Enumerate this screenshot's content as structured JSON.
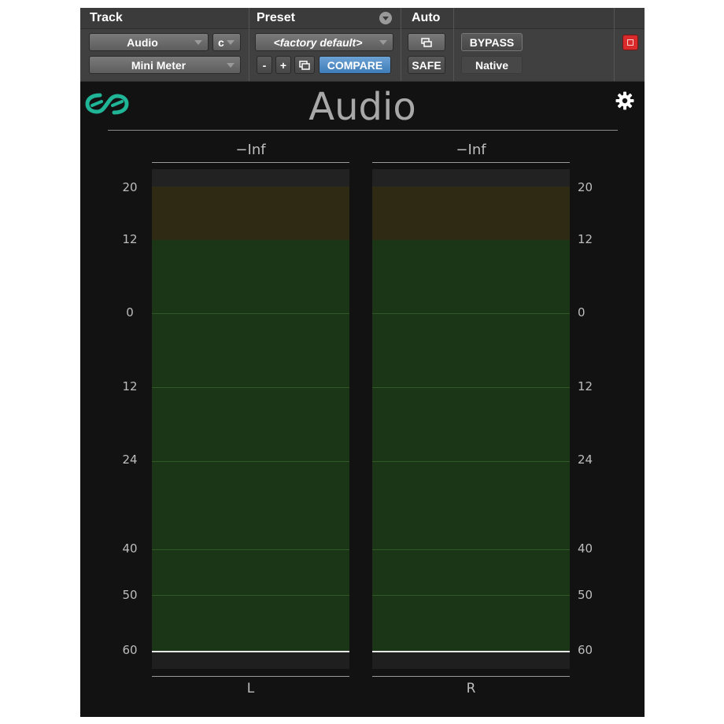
{
  "header": {
    "track_title": "Track",
    "preset_title": "Preset",
    "auto_title": "Auto",
    "track_name": "Audio",
    "channel": "c",
    "plugin_name": "Mini Meter",
    "preset_name": "<factory default>",
    "minus_label": "-",
    "plus_label": "+",
    "compare_label": "COMPARE",
    "safe_label": "SAFE",
    "bypass_label": "BYPASS",
    "native_label": "Native"
  },
  "plugin": {
    "title": "Audio",
    "accent_color": "#1fb596"
  },
  "meters": {
    "channels": [
      {
        "label": "L",
        "peak": "−Inf"
      },
      {
        "label": "R",
        "peak": "−Inf"
      }
    ],
    "scale_labels": [
      "20",
      "12",
      "0",
      "12",
      "24",
      "40",
      "50",
      "60"
    ],
    "colors": {
      "hot": "#2f2a14",
      "normal": "#1b3517"
    }
  }
}
